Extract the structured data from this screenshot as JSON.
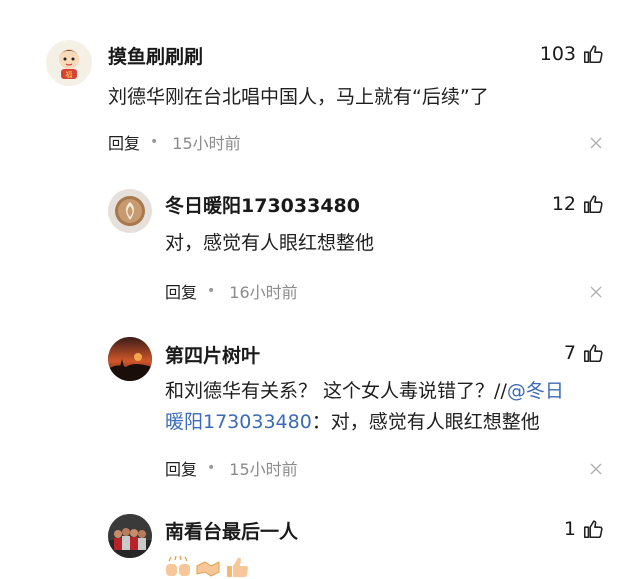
{
  "comments": [
    {
      "username": "摸鱼刷刷刷",
      "likes": "103",
      "content": "刘德华刚在台北唱中国人，马上就有“后续”了",
      "reply_label": "回复",
      "time": "15小时前",
      "avatar": "cartoon-character-avatar"
    },
    {
      "username": "冬日暖阳173033480",
      "likes": "12",
      "content": "对，感觉有人眼红想整他",
      "reply_label": "回复",
      "time": "16小时前",
      "avatar": "coffee-latte-avatar"
    },
    {
      "username": "第四片树叶",
      "likes": "7",
      "content_prefix": "和刘德华有关系？ 这个女人毒说错了？//",
      "mention_line1": "@冬日",
      "mention_line2": "暖阳173033480",
      "content_suffix": "：对，感觉有人眼红想整他",
      "reply_label": "回复",
      "time": "15小时前",
      "avatar": "sunset-silhouette-avatar"
    },
    {
      "username": "南看台最后一人",
      "likes": "1",
      "emojis": [
        "fist-bump-emoji",
        "handshake-emoji",
        "thumbs-up-emoji"
      ],
      "avatar": "team-photo-avatar"
    }
  ],
  "colors": {
    "mention": "#3b6bb8",
    "time": "#8c8c8c",
    "text": "#1f1f1f"
  }
}
